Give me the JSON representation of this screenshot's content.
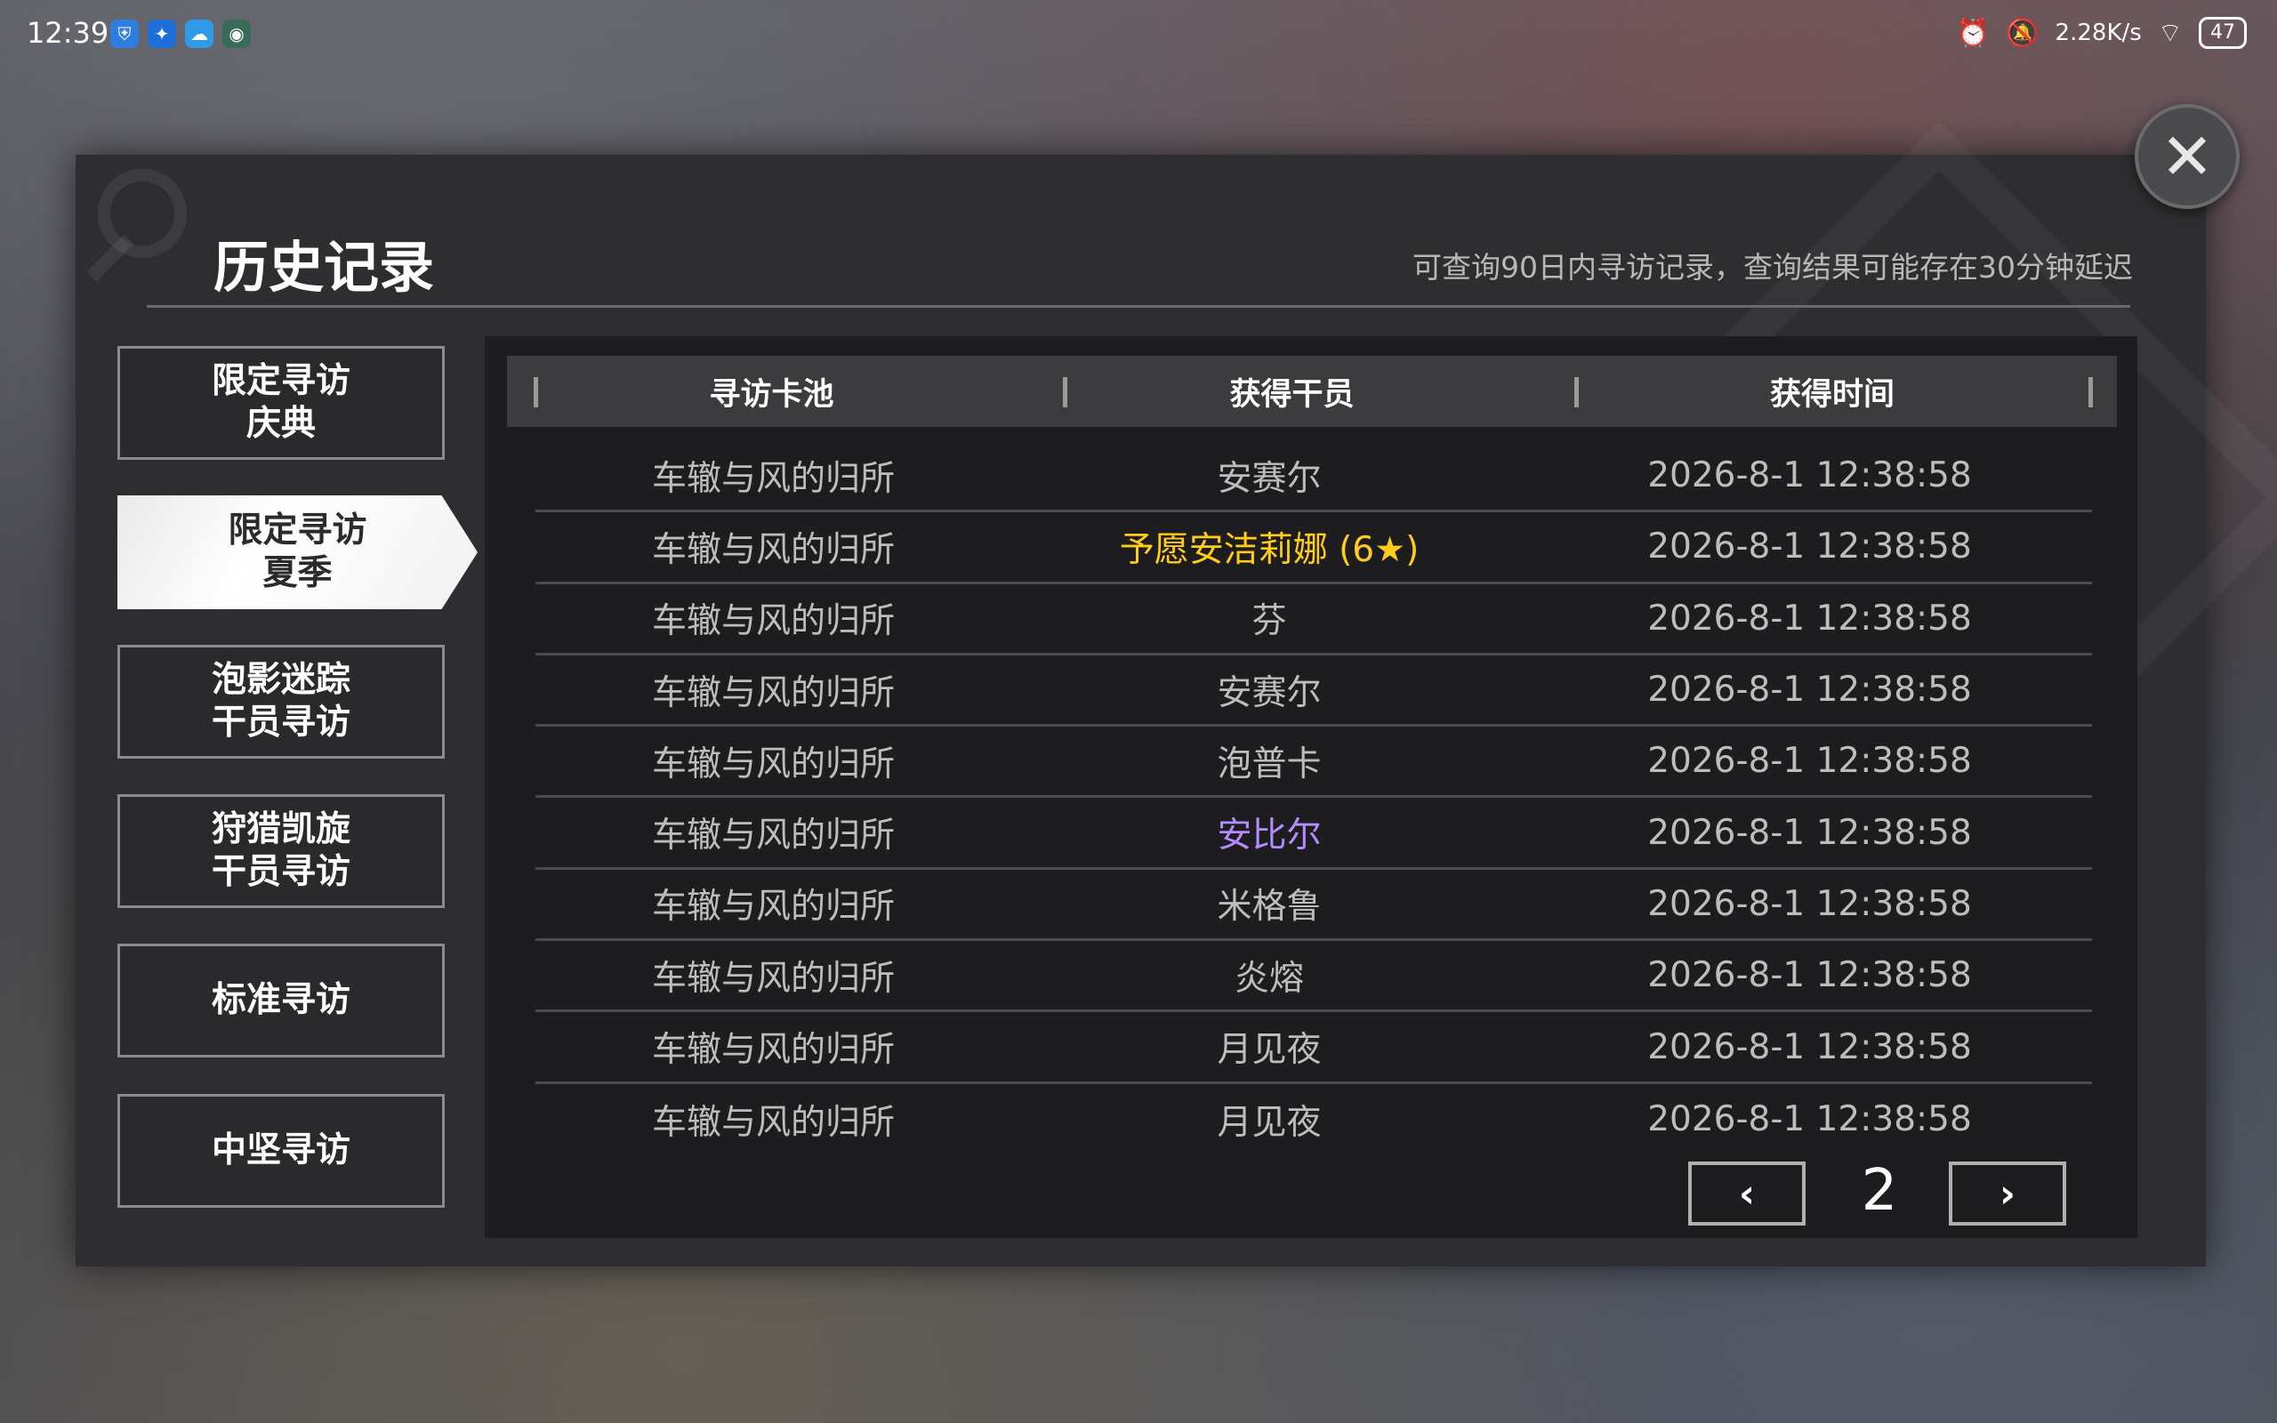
{
  "status_bar": {
    "time": "12:39",
    "net_speed": "2.28K/s",
    "battery": "47"
  },
  "header": {
    "title": "历史记录",
    "subtitle": "可查询90日内寻访记录，查询结果可能存在30分钟延迟"
  },
  "sidebar": {
    "tabs": [
      {
        "line1": "限定寻访",
        "line2": "庆典"
      },
      {
        "line1": "限定寻访",
        "line2": "夏季"
      },
      {
        "line1": "泡影迷踪",
        "line2": "干员寻访"
      },
      {
        "line1": "狩猎凯旋",
        "line2": "干员寻访"
      },
      {
        "line1": "标准寻访",
        "line2": ""
      },
      {
        "line1": "中坚寻访",
        "line2": ""
      }
    ]
  },
  "table": {
    "headers": [
      "寻访卡池",
      "获得干员",
      "获得时间"
    ],
    "rows": [
      {
        "pool": "车辙与风的归所",
        "operator": "安赛尔",
        "time": "2026-8-1 12:38:58"
      },
      {
        "pool": "车辙与风的归所",
        "operator": "予愿安洁莉娜 (6★)",
        "time": "2026-8-1 12:38:58"
      },
      {
        "pool": "车辙与风的归所",
        "operator": "芬",
        "time": "2026-8-1 12:38:58"
      },
      {
        "pool": "车辙与风的归所",
        "operator": "安赛尔",
        "time": "2026-8-1 12:38:58"
      },
      {
        "pool": "车辙与风的归所",
        "operator": "泡普卡",
        "time": "2026-8-1 12:38:58"
      },
      {
        "pool": "车辙与风的归所",
        "operator": "安比尔",
        "time": "2026-8-1 12:38:58"
      },
      {
        "pool": "车辙与风的归所",
        "operator": "米格鲁",
        "time": "2026-8-1 12:38:58"
      },
      {
        "pool": "车辙与风的归所",
        "operator": "炎熔",
        "time": "2026-8-1 12:38:58"
      },
      {
        "pool": "车辙与风的归所",
        "operator": "月见夜",
        "time": "2026-8-1 12:38:58"
      },
      {
        "pool": "车辙与风的归所",
        "operator": "月见夜",
        "time": "2026-8-1 12:38:58"
      }
    ]
  },
  "pager": {
    "page": "2",
    "prev_icon": "chevron-left-icon",
    "next_icon": "chevron-right-icon"
  },
  "colors": {
    "six_star": "#ffcc1a",
    "four_star": "#b58cff",
    "default_text": "#bdbdbd"
  }
}
